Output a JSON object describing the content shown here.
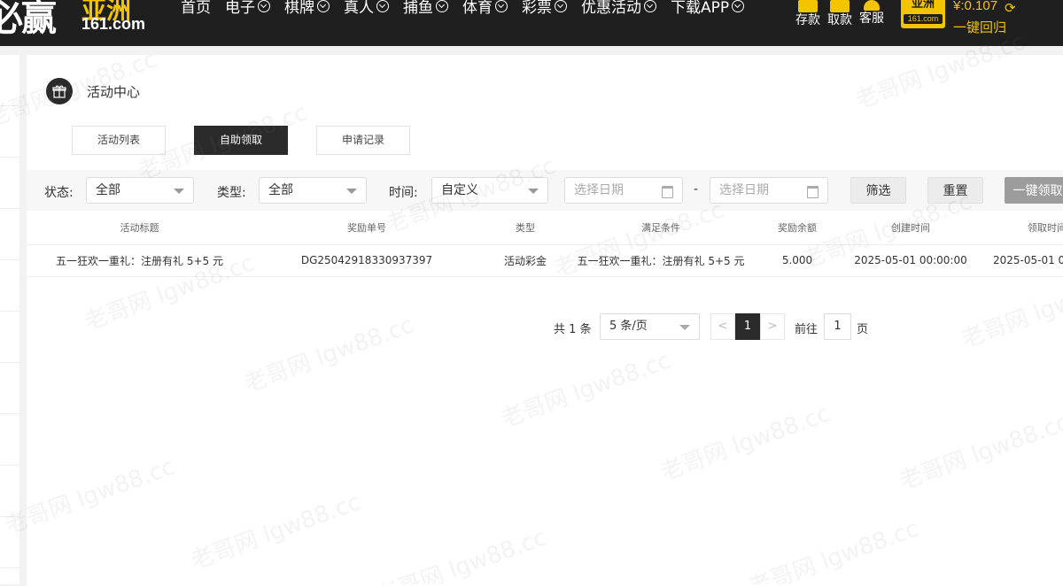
{
  "header": {
    "logo_main": "必赢",
    "logo_sub": "亚洲",
    "logo_domain": "161.com",
    "nav": [
      {
        "label": "首页",
        "has_dropdown": false
      },
      {
        "label": "电子",
        "has_dropdown": true
      },
      {
        "label": "棋牌",
        "has_dropdown": true
      },
      {
        "label": "真人",
        "has_dropdown": true
      },
      {
        "label": "捕鱼",
        "has_dropdown": true
      },
      {
        "label": "体育",
        "has_dropdown": true
      },
      {
        "label": "彩票",
        "has_dropdown": true
      },
      {
        "label": "优惠活动",
        "has_dropdown": true
      },
      {
        "label": "下载APP",
        "has_dropdown": true
      }
    ],
    "tools": {
      "deposit": "存款",
      "withdraw": "取款",
      "service": "客服"
    },
    "badge_text": "亚洲",
    "badge_domain": "161.com",
    "balance": "¥:0.107",
    "recover_label": "一键回归",
    "accent_color": "#f5c400",
    "bar_color": "#1f1f1f"
  },
  "page": {
    "title": "活动中心",
    "icon": "gift-icon"
  },
  "tabs": [
    {
      "label": "活动列表",
      "active": false
    },
    {
      "label": "自助领取",
      "active": true
    },
    {
      "label": "申请记录",
      "active": false
    }
  ],
  "filters": {
    "status_label": "状态:",
    "status_value": "全部",
    "type_label": "类型:",
    "type_value": "全部",
    "time_label": "时间:",
    "time_value": "自定义",
    "date_start_placeholder": "选择日期",
    "date_end_placeholder": "选择日期",
    "date_separator": "-",
    "filter_button": "筛选",
    "reset_button": "重置",
    "claim_all_button": "一键领取"
  },
  "table": {
    "columns": [
      "活动标题",
      "奖励单号",
      "类型",
      "满足条件",
      "奖励余额",
      "创建时间",
      "领取时间"
    ],
    "rows": [
      [
        "五一狂欢一重礼：注册有礼 5+5 元",
        "DG25042918330937397",
        "活动彩金",
        "五一狂欢一重礼：注册有礼 5+5 元",
        "5.000",
        "2025-05-01 00:00:00",
        "2025-05-01 0"
      ]
    ]
  },
  "pagination": {
    "total_text": "共 1 条",
    "page_size": "5 条/页",
    "prev": "<",
    "current_page": "1",
    "next": ">",
    "goto_label": "前往",
    "goto_value": "1",
    "page_label": "页"
  },
  "watermark": "老哥网 lgw88.cc"
}
